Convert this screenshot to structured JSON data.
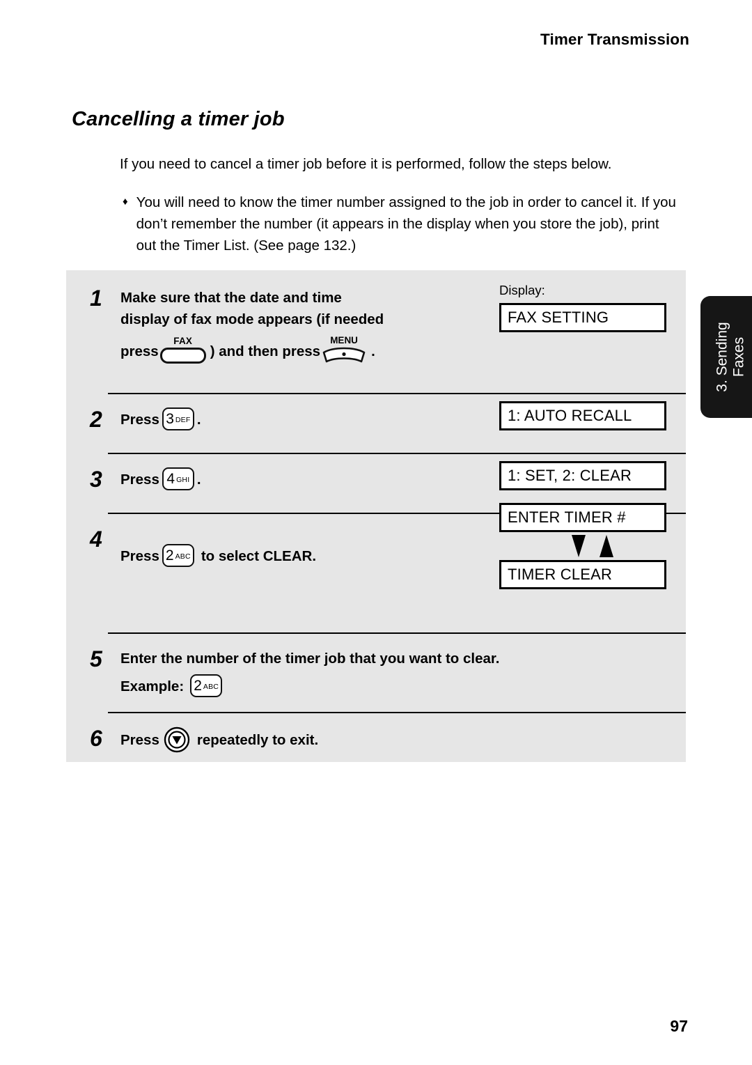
{
  "header": {
    "running_title": "Timer Transmission"
  },
  "section": {
    "heading": "Cancelling a timer job"
  },
  "intro": {
    "paragraph": "If you need to cancel a timer job before it is performed, follow the steps below.",
    "bullet_marker": "♦",
    "bullet": "You will need to know the timer number assigned to the job in order to cancel it. If you don’t remember the number (it appears in the display when you store the job), print out the Timer List. (See page 132.)"
  },
  "display_column": {
    "label": "Display:"
  },
  "steps": [
    {
      "number": "1",
      "line1": "Make sure that the date and time",
      "line2": "display of fax mode appears (if needed",
      "line3_pre": "press",
      "key_fax_label": "FAX",
      "line3_mid": ") and then press",
      "key_menu_label": "MENU",
      "line3_post": ".",
      "display": "FAX SETTING"
    },
    {
      "number": "2",
      "press_label": "Press",
      "key_digit": "3",
      "key_letters": "DEF",
      "after": ".",
      "display": "1: AUTO RECALL"
    },
    {
      "number": "3",
      "press_label": "Press",
      "key_digit": "4",
      "key_letters": "GHI",
      "after": ".",
      "display": "1: SET, 2: CLEAR"
    },
    {
      "number": "4",
      "press_label": "Press",
      "key_digit": "2",
      "key_letters": "ABC",
      "after": "to select CLEAR.",
      "display": "ENTER TIMER #",
      "display_alt": "TIMER CLEAR",
      "arrow_down": "down-arrow-icon",
      "arrow_up": "up-arrow-icon"
    },
    {
      "number": "5",
      "line1": "Enter the number of the timer job that you want to clear.",
      "example_label": "Example:",
      "key_digit": "2",
      "key_letters": "ABC"
    },
    {
      "number": "6",
      "press_label": "Press",
      "key_stop": "stop-key-icon",
      "after": "repeatedly to exit."
    }
  ],
  "side_tab": {
    "line1": "3. Sending",
    "line2": "Faxes"
  },
  "folio": {
    "page_number": "97"
  },
  "colors": {
    "panel_background": "#e6e6e6",
    "side_tab_background": "#161616",
    "ink": "#000000",
    "paper": "#ffffff"
  }
}
